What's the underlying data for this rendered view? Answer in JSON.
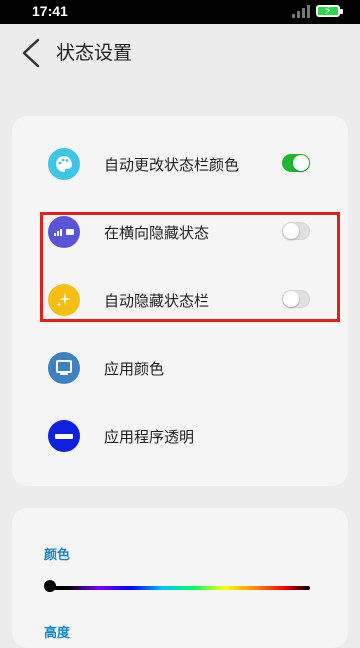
{
  "status_bar": {
    "time": "17:41"
  },
  "header": {
    "title": "状态设置"
  },
  "settings": {
    "items": [
      {
        "label": "自动更改状态栏颜色",
        "icon": "palette-icon",
        "icon_color": "#3cc6e8",
        "toggle": true
      },
      {
        "label": "在横向隐藏状态",
        "icon": "status-bar-icon",
        "icon_color": "#5a55d6",
        "toggle": false
      },
      {
        "label": "自动隐藏状态栏",
        "icon": "sparkle-icon",
        "icon_color": "#f5be12",
        "toggle": false
      },
      {
        "label": "应用颜色",
        "icon": "monitor-icon",
        "icon_color": "#3f7fc4"
      },
      {
        "label": "应用程序透明",
        "icon": "minus-circle-icon",
        "icon_color": "#1020e0"
      }
    ]
  },
  "sliders": {
    "color_label": "颜色",
    "height_label": "高度",
    "color_value": 0
  },
  "colors": {
    "toggle_on": "#1fb632",
    "highlight": "#e0201a",
    "section_label": "#1688c8"
  }
}
